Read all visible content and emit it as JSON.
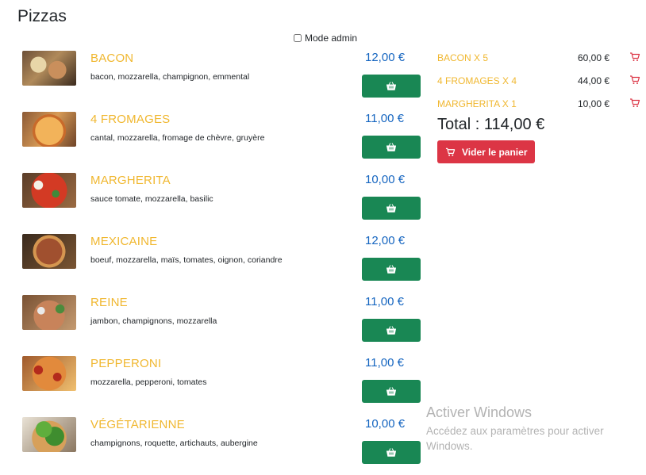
{
  "page_title": "Pizzas",
  "admin_mode": {
    "label": "Mode admin",
    "checked": false
  },
  "colors": {
    "accent": "#f0b72f",
    "price": "#1565c0",
    "add_button": "#198754",
    "danger": "#dc3545"
  },
  "pizzas": [
    {
      "name": "Bacon",
      "description": "bacon, mozzarella, champignon, emmental",
      "price": "12,00 €"
    },
    {
      "name": "4 Fromages",
      "description": "cantal, mozzarella, fromage de chèvre, gruyère",
      "price": "11,00 €"
    },
    {
      "name": "Margherita",
      "description": "sauce tomate, mozzarella, basilic",
      "price": "10,00 €"
    },
    {
      "name": "Mexicaine",
      "description": "boeuf, mozzarella, maïs, tomates, oignon, coriandre",
      "price": "12,00 €"
    },
    {
      "name": "Reine",
      "description": "jambon, champignons, mozzarella",
      "price": "11,00 €"
    },
    {
      "name": "Pepperoni",
      "description": "mozzarella, pepperoni, tomates",
      "price": "11,00 €"
    },
    {
      "name": "Végétarienne",
      "description": "champignons, roquette, artichauts, aubergine",
      "price": "10,00 €"
    }
  ],
  "cart": {
    "items": [
      {
        "label": "Bacon x 5",
        "price": "60,00 €"
      },
      {
        "label": "4 Fromages x 4",
        "price": "44,00 €"
      },
      {
        "label": "Margherita x 1",
        "price": "10,00 €"
      }
    ],
    "total": "Total : 114,00 €",
    "empty_label": "Vider le panier"
  },
  "watermark": {
    "title": "Activer Windows",
    "subtitle": "Accédez aux paramètres pour activer Windows."
  }
}
